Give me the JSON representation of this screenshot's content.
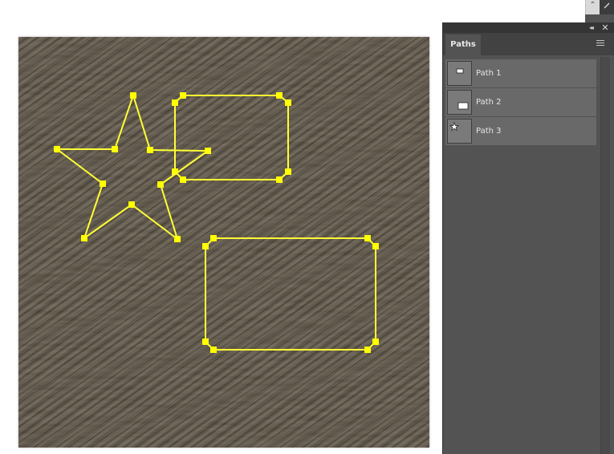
{
  "panel": {
    "tab_label": "Paths",
    "collapse_glyph": "◂◂",
    "close_glyph": "✕"
  },
  "paths": [
    {
      "label": "Path 1",
      "thumb_shape": "small-rectangle"
    },
    {
      "label": "Path 2",
      "thumb_shape": "rectangle"
    },
    {
      "label": "Path 3",
      "thumb_shape": "star"
    }
  ],
  "colors": {
    "path_stroke": "#ffff33",
    "anchor_fill": "#ffff00",
    "panel_bg": "#535353",
    "row_bg": "#696969",
    "texture_base": "#5b5346"
  },
  "scroll": {
    "up_glyph": "⌃"
  }
}
